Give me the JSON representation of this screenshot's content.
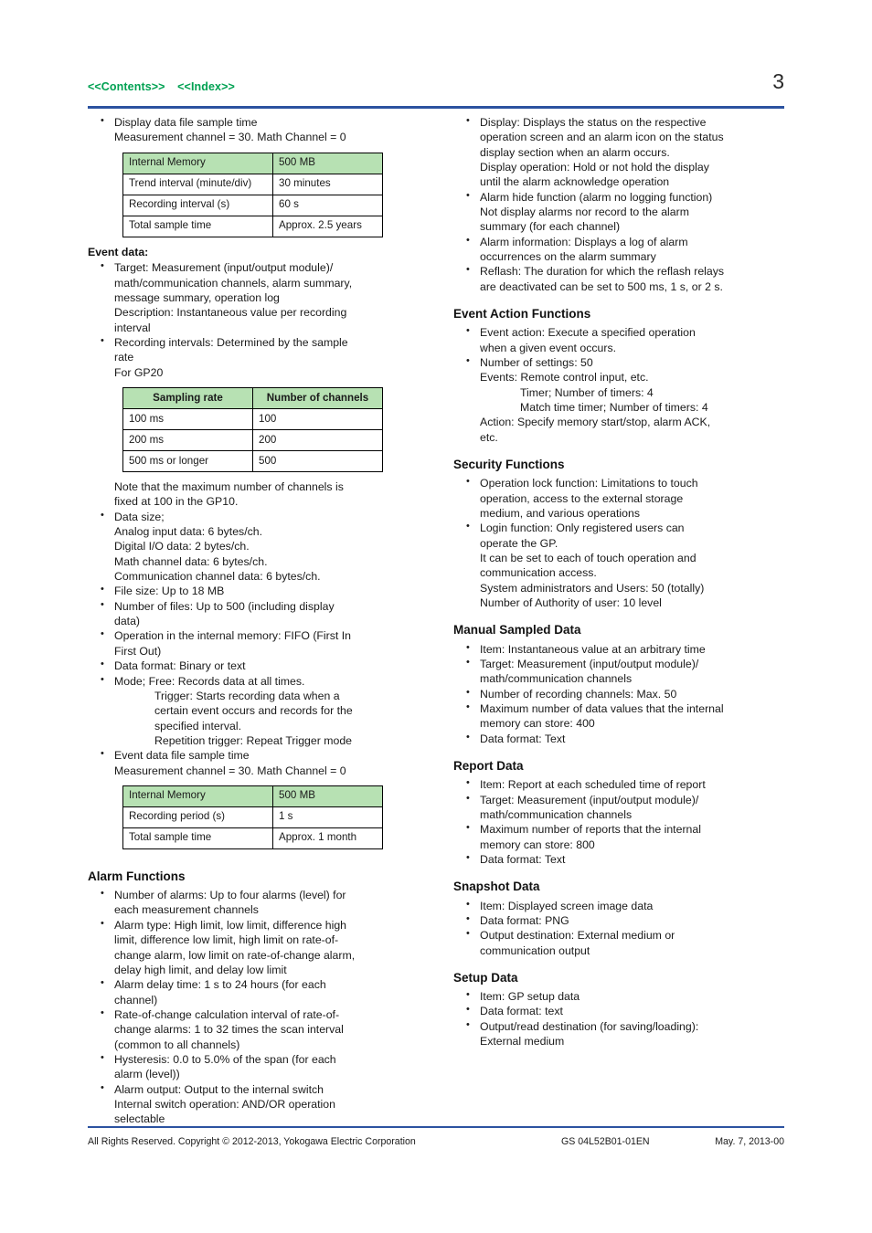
{
  "header": {
    "contents_link": "<<Contents>>",
    "index_link": "<<Index>>",
    "page_number": "3",
    "rule_color": "#2b52a0",
    "link_color": "#00a152"
  },
  "table_header_color": "#b7e1b3",
  "left_column": {
    "display_data_bullet": {
      "line1": "Display data file sample time",
      "line2": "Measurement channel = 30. Math Channel = 0"
    },
    "display_data_table": {
      "header": [
        "Internal Memory",
        "500 MB"
      ],
      "rows": [
        [
          "Trend interval (minute/div)",
          "30 minutes"
        ],
        [
          "Recording interval (s)",
          "60 s"
        ],
        [
          "Total sample time",
          "Approx. 2.5 years"
        ]
      ]
    },
    "event_data": {
      "title": "Event data:",
      "target_line1": "Target: Measurement (input/output module)/",
      "target_line2": "math/communication channels, alarm summary,",
      "target_line3": "message summary, operation log",
      "target_line4": "Description: Instantaneous value per recording",
      "target_line5": "interval",
      "rec_line1": "Recording intervals: Determined by the sample",
      "rec_line2": "rate",
      "rec_line3": "For GP20"
    },
    "sampling_table": {
      "header": [
        "Sampling rate",
        "Number of channels"
      ],
      "rows": [
        [
          "100 ms",
          "100"
        ],
        [
          "200 ms",
          "200"
        ],
        [
          "500 ms or longer",
          "500"
        ]
      ]
    },
    "note": {
      "line1": "Note that the maximum number of channels is",
      "line2": "fixed at 100 in the GP10."
    },
    "data_size": {
      "head": "Data size;",
      "analog": "Analog input data: 6 bytes/ch.",
      "digital": "Digital I/O data: 2 bytes/ch.",
      "math": "Math channel data: 6 bytes/ch.",
      "comm": "Communication channel data: 6 bytes/ch."
    },
    "file_size": "File size: Up to 18 MB",
    "num_files_line1": "Number of files: Up to 500 (including display",
    "num_files_line2": "data)",
    "operation_line1": "Operation in the internal memory: FIFO (First In",
    "operation_line2": "First Out)",
    "data_format": "Data format: Binary or text",
    "mode": {
      "free": "Mode; Free: Records data at all times.",
      "trigger_line1": "Trigger: Starts recording data when a",
      "trigger_line2": "certain event occurs and records for the",
      "trigger_line3": "specified interval.",
      "repetition": "Repetition trigger: Repeat Trigger mode"
    },
    "event_file_bullet": {
      "line1": "Event data file sample time",
      "line2": "Measurement channel = 30. Math Channel = 0"
    },
    "event_data_table": {
      "header": [
        "Internal Memory",
        "500 MB"
      ],
      "rows": [
        [
          "Recording period (s)",
          "1 s"
        ],
        [
          "Total sample time",
          "Approx. 1 month"
        ]
      ]
    },
    "alarm_functions": {
      "title": "Alarm Functions",
      "items": [
        {
          "line1": "Number of alarms: Up to four alarms (level) for",
          "line2": "each measurement channels"
        },
        {
          "line1": "Alarm type: High limit, low limit, difference high",
          "line2": "limit, difference low limit, high limit on rate-of-",
          "line3": "change alarm, low limit on rate-of-change alarm,",
          "line4": "delay high limit, and delay low limit"
        },
        {
          "line1": "Alarm delay time: 1 s to 24 hours (for each",
          "line2": "channel)"
        },
        {
          "line1": "Rate-of-change calculation interval of rate-of-",
          "line2": "change alarms: 1 to 32 times the scan interval",
          "line3": "(common to all channels)"
        },
        {
          "line1": "Hysteresis: 0.0 to 5.0% of the span (for each",
          "line2": "alarm (level))"
        },
        {
          "line1": "Alarm output: Output to the internal switch",
          "line2": "Internal switch operation: AND/OR operation",
          "line3": "selectable"
        }
      ]
    }
  },
  "right_column": {
    "alarm_continued": [
      {
        "line1": "Display: Displays the status on the respective",
        "line2": "operation screen and an alarm icon on the status",
        "line3": "display section when an alarm occurs.",
        "line4": "Display operation: Hold or not hold the display",
        "line5": "until the alarm acknowledge operation"
      },
      {
        "line1": "Alarm hide function (alarm no logging function)",
        "line2": "Not display alarms nor record to the alarm",
        "line3": "summary (for each channel)"
      },
      {
        "line1": "Alarm information: Displays a log of alarm",
        "line2": "occurrences on the alarm summary"
      },
      {
        "line1": "Reflash: The duration for which the reflash relays",
        "line2": "are deactivated can be set to 500 ms, 1 s, or 2 s."
      }
    ],
    "event_action": {
      "title": "Event Action Functions",
      "item1_line1": "Event action: Execute a specified operation",
      "item1_line2": "when a given event occurs.",
      "item2_line1": "Number of settings: 50",
      "item2_line2": "Events: Remote control input, etc.",
      "item2_line3": "Timer; Number of timers: 4",
      "item2_line4": "Match time timer; Number of timers: 4",
      "item2_line5": "Action: Specify memory start/stop, alarm ACK,",
      "item2_line6": "etc."
    },
    "security": {
      "title": "Security Functions",
      "item1_line1": "Operation lock function: Limitations to touch",
      "item1_line2": "operation, access to the external storage",
      "item1_line3": "medium, and various operations",
      "item2_line1": "Login function: Only registered users can",
      "item2_line2": "operate the GP.",
      "item2_line3": "It can be set to each of touch operation and",
      "item2_line4": "communication access.",
      "item2_line5": "System administrators and Users: 50 (totally)",
      "item2_line6": "Number of Authority of user: 10 level"
    },
    "manual_sampled": {
      "title": "Manual Sampled Data",
      "item1": "Item: Instantaneous value at an arbitrary time",
      "item2_line1": "Target: Measurement (input/output module)/",
      "item2_line2": "math/communication channels",
      "item3": "Number of recording channels: Max. 50",
      "item4_line1": "Maximum number of data values that the internal",
      "item4_line2": "memory can store: 400",
      "item5": "Data format: Text"
    },
    "report": {
      "title": "Report Data",
      "item1": "Item: Report at each scheduled time of report",
      "item2_line1": "Target: Measurement (input/output module)/",
      "item2_line2": "math/communication channels",
      "item3_line1": "Maximum number of reports that the internal",
      "item3_line2": "memory can store: 800",
      "item4": "Data format: Text"
    },
    "snapshot": {
      "title": "Snapshot Data",
      "item1": "Item: Displayed screen image data",
      "item2": "Data format: PNG",
      "item3_line1": "Output destination: External medium or",
      "item3_line2": "communication output"
    },
    "setup": {
      "title": "Setup Data",
      "item1": "Item: GP setup data",
      "item2": "Data format: text",
      "item3_line1": "Output/read destination (for saving/loading):",
      "item3_line2": "External medium"
    }
  },
  "footer": {
    "copyright": "All Rights Reserved. Copyright © 2012-2013, Yokogawa Electric Corporation",
    "gs_number": "GS 04L52B01-01EN",
    "date": "May. 7, 2013-00"
  }
}
